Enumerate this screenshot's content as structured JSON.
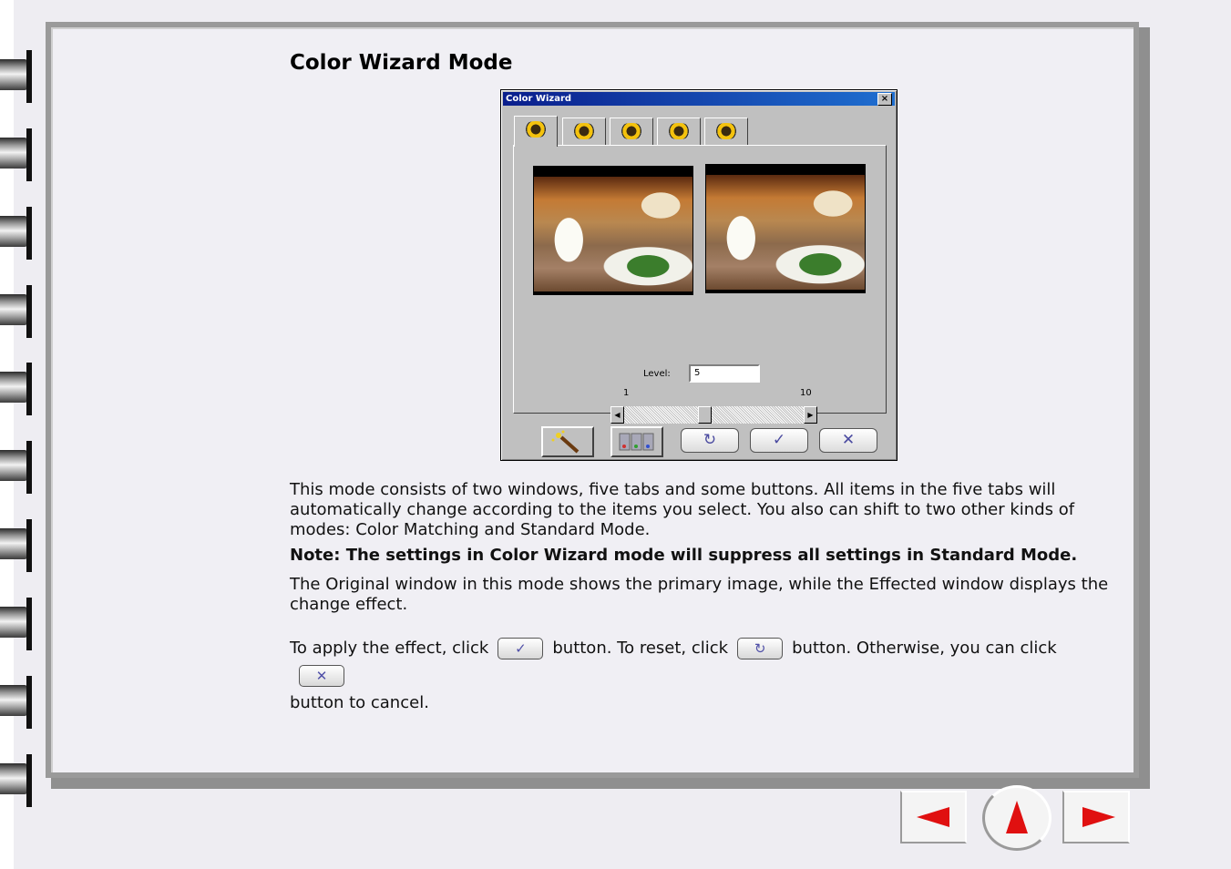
{
  "heading": "Color Wizard Mode",
  "dialog": {
    "title": "Color Wizard",
    "close_glyph": "×",
    "tabs": [
      "tab-1",
      "tab-2",
      "tab-3",
      "tab-4",
      "tab-5"
    ],
    "level_label": "Level:",
    "level_value": "5",
    "slider_min": "1",
    "slider_max": "10",
    "slider_value": 5,
    "buttons": {
      "wizard_icon": "magic-wand-icon",
      "palette_icon": "color-samples-icon",
      "reset_glyph": "↻",
      "apply_glyph": "✓",
      "cancel_glyph": "✕"
    }
  },
  "body": {
    "para1": "This mode consists of two windows, five tabs and some buttons. All items in the five tabs will automatically change according to the items you select. You also can shift to two other kinds of modes: Color Matching and Standard Mode.",
    "note": "Note: The settings in Color Wizard mode will suppress all settings in Standard Mode.",
    "para2": "The Original window in this mode shows the primary image, while the Effected window displays the change effect.",
    "apply_pre": "To apply the effect, click",
    "apply_post": "button. To reset, click",
    "reset_post": "button. Otherwise, you can click",
    "cancel_post": "button to cancel."
  },
  "nav": {
    "prev_icon": "arrow-left-icon",
    "up_icon": "arrow-up-icon",
    "next_icon": "arrow-right-icon"
  },
  "colors": {
    "accent": "#e01010",
    "titlebar": "#0a1e8c"
  }
}
